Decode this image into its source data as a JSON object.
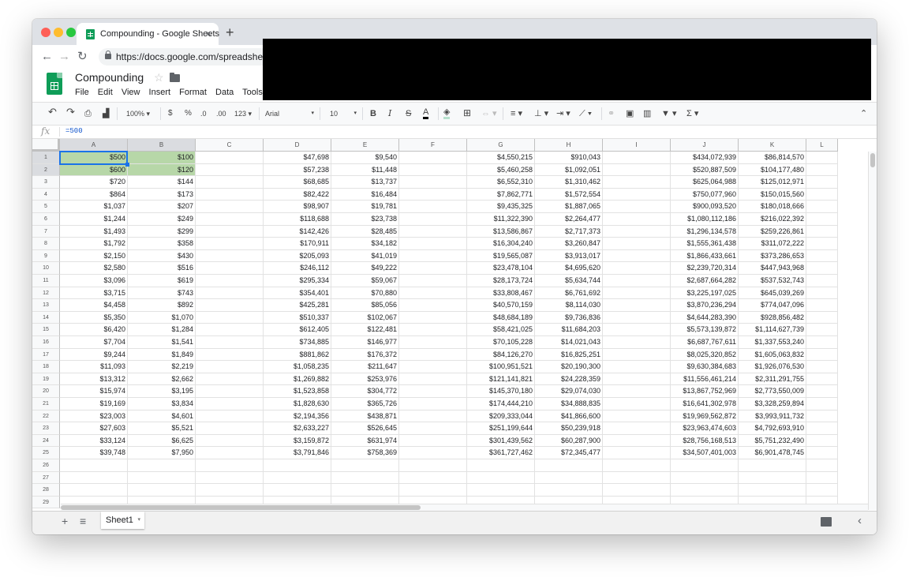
{
  "browser": {
    "tab_title": "Compounding - Google Sheets",
    "tab_close": "×",
    "new_tab": "+",
    "url": "https://docs.google.com/spreadsheets"
  },
  "doc": {
    "title": "Compounding",
    "menus": [
      "File",
      "Edit",
      "View",
      "Insert",
      "Format",
      "Data",
      "Tools"
    ]
  },
  "toolbar": {
    "zoom": "100%",
    "currency": "$",
    "percent": "%",
    "dec_decrease": ".0",
    "dec_increase": ".00",
    "more_formats": "123",
    "font": "Arial",
    "font_size": "10",
    "bold": "B",
    "italic": "I",
    "strike": "S",
    "text_color": "A",
    "functions": "Σ"
  },
  "formula_bar": {
    "fx": "fx",
    "value": "=500"
  },
  "grid": {
    "columns": [
      "A",
      "B",
      "C",
      "D",
      "E",
      "F",
      "G",
      "H",
      "I",
      "J",
      "K",
      "L"
    ],
    "row_numbers": [
      "1",
      "2",
      "3",
      "4",
      "5",
      "6",
      "7",
      "8",
      "9",
      "10",
      "11",
      "12",
      "13",
      "14",
      "15",
      "16",
      "17",
      "18",
      "19",
      "20",
      "21",
      "22",
      "23",
      "24",
      "25",
      "26",
      "27",
      "28",
      "29"
    ],
    "rows": [
      [
        "$500",
        "$100",
        "",
        "$47,698",
        "$9,540",
        "",
        "$4,550,215",
        "$910,043",
        "",
        "$434,072,939",
        "$86,814,570",
        ""
      ],
      [
        "$600",
        "$120",
        "",
        "$57,238",
        "$11,448",
        "",
        "$5,460,258",
        "$1,092,051",
        "",
        "$520,887,509",
        "$104,177,480",
        ""
      ],
      [
        "$720",
        "$144",
        "",
        "$68,685",
        "$13,737",
        "",
        "$6,552,310",
        "$1,310,462",
        "",
        "$625,064,988",
        "$125,012,971",
        ""
      ],
      [
        "$864",
        "$173",
        "",
        "$82,422",
        "$16,484",
        "",
        "$7,862,771",
        "$1,572,554",
        "",
        "$750,077,960",
        "$150,015,560",
        ""
      ],
      [
        "$1,037",
        "$207",
        "",
        "$98,907",
        "$19,781",
        "",
        "$9,435,325",
        "$1,887,065",
        "",
        "$900,093,520",
        "$180,018,666",
        ""
      ],
      [
        "$1,244",
        "$249",
        "",
        "$118,688",
        "$23,738",
        "",
        "$11,322,390",
        "$2,264,477",
        "",
        "$1,080,112,186",
        "$216,022,392",
        ""
      ],
      [
        "$1,493",
        "$299",
        "",
        "$142,426",
        "$28,485",
        "",
        "$13,586,867",
        "$2,717,373",
        "",
        "$1,296,134,578",
        "$259,226,861",
        ""
      ],
      [
        "$1,792",
        "$358",
        "",
        "$170,911",
        "$34,182",
        "",
        "$16,304,240",
        "$3,260,847",
        "",
        "$1,555,361,438",
        "$311,072,222",
        ""
      ],
      [
        "$2,150",
        "$430",
        "",
        "$205,093",
        "$41,019",
        "",
        "$19,565,087",
        "$3,913,017",
        "",
        "$1,866,433,661",
        "$373,286,653",
        ""
      ],
      [
        "$2,580",
        "$516",
        "",
        "$246,112",
        "$49,222",
        "",
        "$23,478,104",
        "$4,695,620",
        "",
        "$2,239,720,314",
        "$447,943,968",
        ""
      ],
      [
        "$3,096",
        "$619",
        "",
        "$295,334",
        "$59,067",
        "",
        "$28,173,724",
        "$5,634,744",
        "",
        "$2,687,664,282",
        "$537,532,743",
        ""
      ],
      [
        "$3,715",
        "$743",
        "",
        "$354,401",
        "$70,880",
        "",
        "$33,808,467",
        "$6,761,692",
        "",
        "$3,225,197,025",
        "$645,039,269",
        ""
      ],
      [
        "$4,458",
        "$892",
        "",
        "$425,281",
        "$85,056",
        "",
        "$40,570,159",
        "$8,114,030",
        "",
        "$3,870,236,294",
        "$774,047,096",
        ""
      ],
      [
        "$5,350",
        "$1,070",
        "",
        "$510,337",
        "$102,067",
        "",
        "$48,684,189",
        "$9,736,836",
        "",
        "$4,644,283,390",
        "$928,856,482",
        ""
      ],
      [
        "$6,420",
        "$1,284",
        "",
        "$612,405",
        "$122,481",
        "",
        "$58,421,025",
        "$11,684,203",
        "",
        "$5,573,139,872",
        "$1,114,627,739",
        ""
      ],
      [
        "$7,704",
        "$1,541",
        "",
        "$734,885",
        "$146,977",
        "",
        "$70,105,228",
        "$14,021,043",
        "",
        "$6,687,767,611",
        "$1,337,553,240",
        ""
      ],
      [
        "$9,244",
        "$1,849",
        "",
        "$881,862",
        "$176,372",
        "",
        "$84,126,270",
        "$16,825,251",
        "",
        "$8,025,320,852",
        "$1,605,063,832",
        ""
      ],
      [
        "$11,093",
        "$2,219",
        "",
        "$1,058,235",
        "$211,647",
        "",
        "$100,951,521",
        "$20,190,300",
        "",
        "$9,630,384,683",
        "$1,926,076,530",
        ""
      ],
      [
        "$13,312",
        "$2,662",
        "",
        "$1,269,882",
        "$253,976",
        "",
        "$121,141,821",
        "$24,228,359",
        "",
        "$11,556,461,214",
        "$2,311,291,755",
        ""
      ],
      [
        "$15,974",
        "$3,195",
        "",
        "$1,523,858",
        "$304,772",
        "",
        "$145,370,180",
        "$29,074,030",
        "",
        "$13,867,752,969",
        "$2,773,550,009",
        ""
      ],
      [
        "$19,169",
        "$3,834",
        "",
        "$1,828,630",
        "$365,726",
        "",
        "$174,444,210",
        "$34,888,835",
        "",
        "$16,641,302,978",
        "$3,328,259,894",
        ""
      ],
      [
        "$23,003",
        "$4,601",
        "",
        "$2,194,356",
        "$438,871",
        "",
        "$209,333,044",
        "$41,866,600",
        "",
        "$19,969,562,872",
        "$3,993,911,732",
        ""
      ],
      [
        "$27,603",
        "$5,521",
        "",
        "$2,633,227",
        "$526,645",
        "",
        "$251,199,644",
        "$50,239,918",
        "",
        "$23,963,474,603",
        "$4,792,693,910",
        ""
      ],
      [
        "$33,124",
        "$6,625",
        "",
        "$3,159,872",
        "$631,974",
        "",
        "$301,439,562",
        "$60,287,900",
        "",
        "$28,756,168,513",
        "$5,751,232,490",
        ""
      ],
      [
        "$39,748",
        "$7,950",
        "",
        "$3,791,846",
        "$758,369",
        "",
        "$361,727,462",
        "$72,345,477",
        "",
        "$34,507,401,003",
        "$6,901,478,745",
        ""
      ],
      [
        "",
        "",
        "",
        "",
        "",
        "",
        "",
        "",
        "",
        "",
        "",
        ""
      ],
      [
        "",
        "",
        "",
        "",
        "",
        "",
        "",
        "",
        "",
        "",
        "",
        ""
      ],
      [
        "",
        "",
        "",
        "",
        "",
        "",
        "",
        "",
        "",
        "",
        "",
        ""
      ],
      [
        "",
        "",
        "",
        "",
        "",
        "",
        "",
        "",
        "",
        "",
        "",
        ""
      ]
    ]
  },
  "sheets": {
    "add": "+",
    "list": "≡",
    "active": "Sheet1",
    "active_dropdown": "▾",
    "collapse": "‹"
  },
  "colors": {
    "highlight": "#b7d7a8",
    "selection": "#1a73e8",
    "brand": "#0f9d58"
  }
}
